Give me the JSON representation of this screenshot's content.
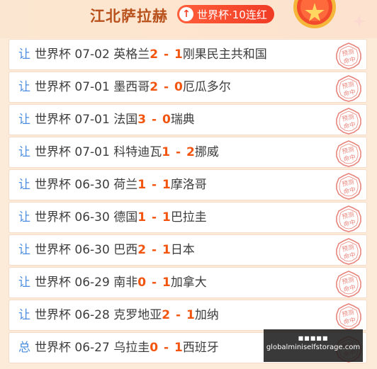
{
  "header": {
    "title": "江北萨拉赫",
    "streak_label": "世界杯·10连红",
    "streak_icon": "arrow-up-icon"
  },
  "colors": {
    "tag": "#4a8de0",
    "score": "#f2550f",
    "stamp": "#e8857d",
    "streak_bg": "#f04428"
  },
  "matches": [
    {
      "tag": "让",
      "league": "世界杯",
      "date": "07-02",
      "home": "英格兰",
      "home_score": "2",
      "away_score": "1",
      "away": "刚果民主共和国",
      "stamp": "预测命中"
    },
    {
      "tag": "让",
      "league": "世界杯",
      "date": "07-01",
      "home": "墨西哥",
      "home_score": "2",
      "away_score": "0",
      "away": "厄瓜多尔",
      "stamp": "预测命中"
    },
    {
      "tag": "让",
      "league": "世界杯",
      "date": "07-01",
      "home": "法国",
      "home_score": "3",
      "away_score": "0",
      "away": "瑞典",
      "stamp": "预测命中"
    },
    {
      "tag": "让",
      "league": "世界杯",
      "date": "07-01",
      "home": "科特迪瓦",
      "home_score": "1",
      "away_score": "2",
      "away": "挪威",
      "stamp": "预测命中"
    },
    {
      "tag": "让",
      "league": "世界杯",
      "date": "06-30",
      "home": "荷兰",
      "home_score": "1",
      "away_score": "1",
      "away": "摩洛哥",
      "stamp": "预测命中"
    },
    {
      "tag": "让",
      "league": "世界杯",
      "date": "06-30",
      "home": "德国",
      "home_score": "1",
      "away_score": "1",
      "away": "巴拉圭",
      "stamp": "预测命中"
    },
    {
      "tag": "让",
      "league": "世界杯",
      "date": "06-30",
      "home": "巴西",
      "home_score": "2",
      "away_score": "1",
      "away": "日本",
      "stamp": "预测命中"
    },
    {
      "tag": "让",
      "league": "世界杯",
      "date": "06-29",
      "home": "南非",
      "home_score": "0",
      "away_score": "1",
      "away": "加拿大",
      "stamp": "预测命中"
    },
    {
      "tag": "让",
      "league": "世界杯",
      "date": "06-28",
      "home": "克罗地亚",
      "home_score": "2",
      "away_score": "1",
      "away": "加纳",
      "stamp": "预测命中"
    },
    {
      "tag": "总",
      "league": "世界杯",
      "date": "06-27",
      "home": "乌拉圭",
      "home_score": "0",
      "away_score": "1",
      "away": "西班牙",
      "stamp": "预测命中"
    }
  ],
  "watermark": {
    "dots": "■■■■■",
    "url": "globalminiselfstorage.com"
  }
}
